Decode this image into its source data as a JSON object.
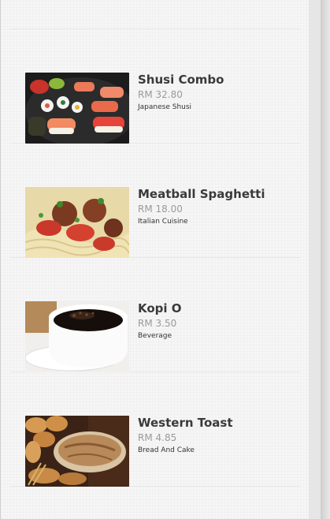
{
  "menu_items": [
    {
      "name": "",
      "price": "",
      "category": "",
      "image": "lasagna-photo"
    },
    {
      "name": "Shusi Combo",
      "price": "RM 32.80",
      "category": "Japanese Shusi",
      "image": "sushi-photo"
    },
    {
      "name": "Meatball Spaghetti",
      "price": "RM 18.00",
      "category": "Italian Cuisine",
      "image": "spaghetti-photo"
    },
    {
      "name": "Kopi O",
      "price": "RM 3.50",
      "category": "Beverage",
      "image": "coffee-photo"
    },
    {
      "name": "Western Toast",
      "price": "RM 4.85",
      "category": "Bread And Cake",
      "image": "bread-photo"
    }
  ],
  "colors": {
    "title": "#3a3a3a",
    "price": "#9a9a9a",
    "category": "#333333",
    "background": "#f6f6f6"
  }
}
